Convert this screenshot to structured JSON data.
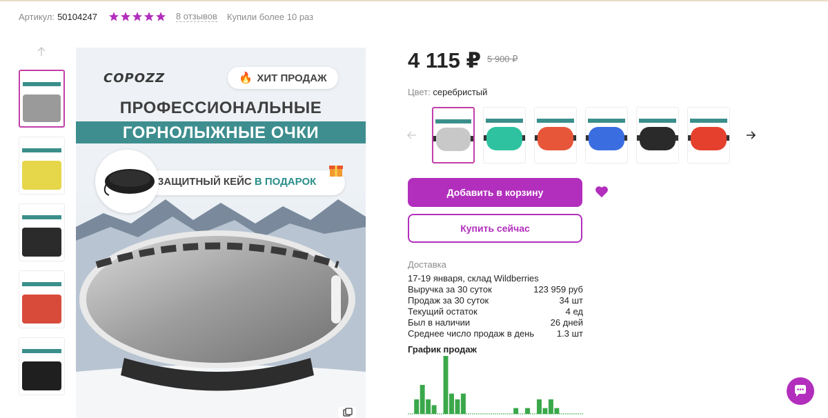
{
  "header": {
    "sku_label": "Артикул:",
    "sku_value": "50104247",
    "rating_stars": 5,
    "reviews": "8 отзывов",
    "purchases": "Купили более 10 раз"
  },
  "gallery": {
    "thumbnails": [
      {
        "name": "thumb-1",
        "active": true,
        "color": "#9a9a9a"
      },
      {
        "name": "thumb-2",
        "active": false,
        "color": "#e5d64a"
      },
      {
        "name": "thumb-3",
        "active": false,
        "color": "#2b2b2b"
      },
      {
        "name": "thumb-4",
        "active": false,
        "color": "#d84b3a"
      },
      {
        "name": "thumb-5",
        "active": false,
        "color": "#1f1f1f"
      }
    ],
    "main_image": {
      "brand": "COPOZZ",
      "badge": "ХИТ ПРОДАЖ",
      "title_line1": "ПРОФЕССИОНАЛЬНЫЕ",
      "title_line2": "ГОРНОЛЫЖНЫЕ ОЧКИ",
      "case_text": "ЗАЩИТНЫЙ КЕЙС",
      "case_highlight": "В ПОДАРОК"
    }
  },
  "product": {
    "price": "4 115 ₽",
    "old_price": "5 900 ₽",
    "color_label": "Цвет:",
    "color_value": "серебристый",
    "variants": [
      {
        "lens": "#c8c8c8",
        "active": true
      },
      {
        "lens": "#2ec2a0",
        "active": false
      },
      {
        "lens": "#e8563a",
        "active": false
      },
      {
        "lens": "#3a6de0",
        "active": false
      },
      {
        "lens": "#2a2a2a",
        "active": false
      },
      {
        "lens": "#e4402d",
        "active": false
      }
    ],
    "add_to_cart": "Добавить в корзину",
    "buy_now": "Купить сейчас"
  },
  "delivery": {
    "label": "Доставка",
    "value": "17-19 января, склад Wildberries"
  },
  "stats": [
    {
      "label": "Выручка за 30 суток",
      "value": "123 959 руб"
    },
    {
      "label": "Продаж за 30 суток",
      "value": "34 шт"
    },
    {
      "label": "Текущий остаток",
      "value": "4 ед"
    },
    {
      "label": "Был в наличии",
      "value": "26 дней"
    },
    {
      "label": "Среднее число продаж в день",
      "value": "1.3 шт"
    }
  ],
  "sales_chart": {
    "title": "График продаж",
    "values": [
      0,
      5,
      10,
      5,
      3,
      0,
      20,
      7,
      5,
      7,
      0,
      0,
      0,
      0,
      0,
      0,
      0,
      0,
      2,
      0,
      2,
      0,
      5,
      2,
      5,
      2,
      0,
      0,
      0,
      0
    ],
    "max": 20
  },
  "colors": {
    "accent": "#b22ebd",
    "teal": "#3e8e8f",
    "chart_bar": "#3aa84a"
  }
}
